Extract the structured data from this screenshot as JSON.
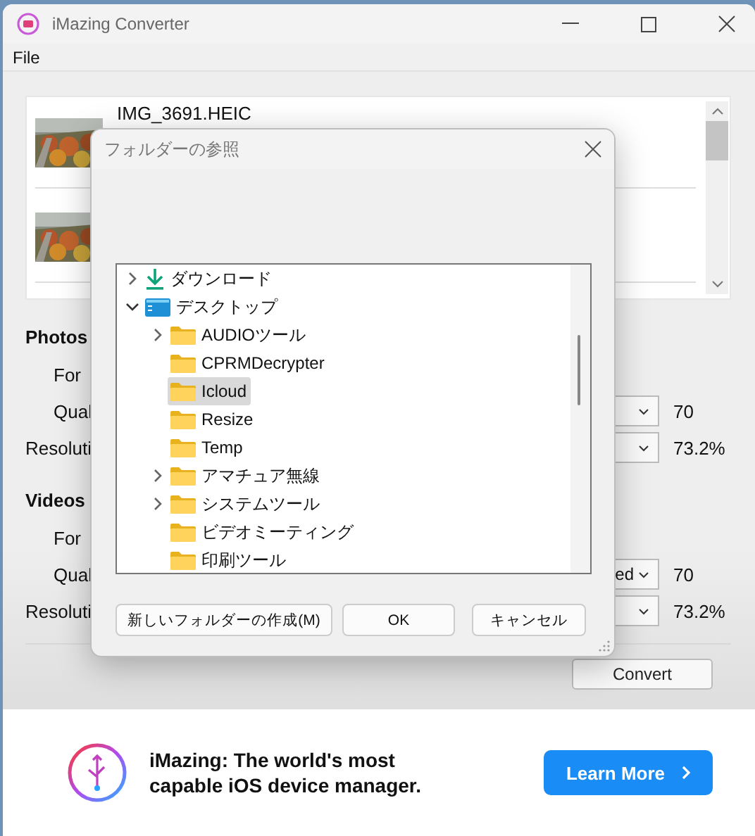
{
  "window": {
    "title": "iMazing Converter"
  },
  "menu": [
    "File"
  ],
  "files": [
    {
      "name": "IMG_3691.HEIC",
      "kind": "picture"
    },
    {
      "kind": "picture"
    }
  ],
  "sections": [
    {
      "title": "Photos",
      "rows": [
        {
          "label": "For",
          "indented": true,
          "kind": "label"
        },
        {
          "label": "Qual",
          "indented": true,
          "kind": "select",
          "reading": "70"
        },
        {
          "label": "Resoluti",
          "indented": false,
          "kind": "select",
          "reading": "73.2%"
        }
      ]
    },
    {
      "title": "Videos",
      "rows": [
        {
          "label": "For",
          "indented": true,
          "kind": "label"
        },
        {
          "label": "Qual",
          "indented": true,
          "kind": "select",
          "value": "ed",
          "reading": "70"
        },
        {
          "label": "Resoluti",
          "indented": false,
          "kind": "select",
          "reading": "73.2%"
        }
      ]
    }
  ],
  "convert_button": "Convert",
  "banner": {
    "text": "iMazing: The world's most capable iOS device manager.",
    "button": "Learn More"
  },
  "dialog": {
    "title": "フォルダーの参照",
    "tree": [
      {
        "label": "ダウンロード",
        "kind": "download",
        "expandable": true,
        "expanded": false,
        "selected": false
      },
      {
        "label": "デスクトップ",
        "kind": "desktop",
        "expandable": true,
        "expanded": true,
        "selected": false,
        "children": [
          {
            "label": "AUDIOツール",
            "kind": "folder",
            "expandable": true,
            "expanded": false,
            "selected": false
          },
          {
            "label": "CPRMDecrypter",
            "kind": "folder",
            "expandable": false,
            "selected": false
          },
          {
            "label": "Icloud",
            "kind": "folder",
            "expandable": false,
            "selected": true
          },
          {
            "label": "Resize",
            "kind": "folder",
            "expandable": false,
            "selected": false
          },
          {
            "label": "Temp",
            "kind": "folder",
            "expandable": false,
            "selected": false
          },
          {
            "label": "アマチュア無線",
            "kind": "folder",
            "expandable": true,
            "expanded": false,
            "selected": false
          },
          {
            "label": "システムツール",
            "kind": "folder",
            "expandable": true,
            "expanded": false,
            "selected": false
          },
          {
            "label": "ビデオミーティング",
            "kind": "folder",
            "expandable": false,
            "selected": false
          },
          {
            "label": "印刷ツール",
            "kind": "folder",
            "expandable": false,
            "selected": false
          }
        ]
      }
    ],
    "buttons": [
      "新しいフォルダーの作成(M)",
      "OK",
      "キャンセル"
    ]
  }
}
